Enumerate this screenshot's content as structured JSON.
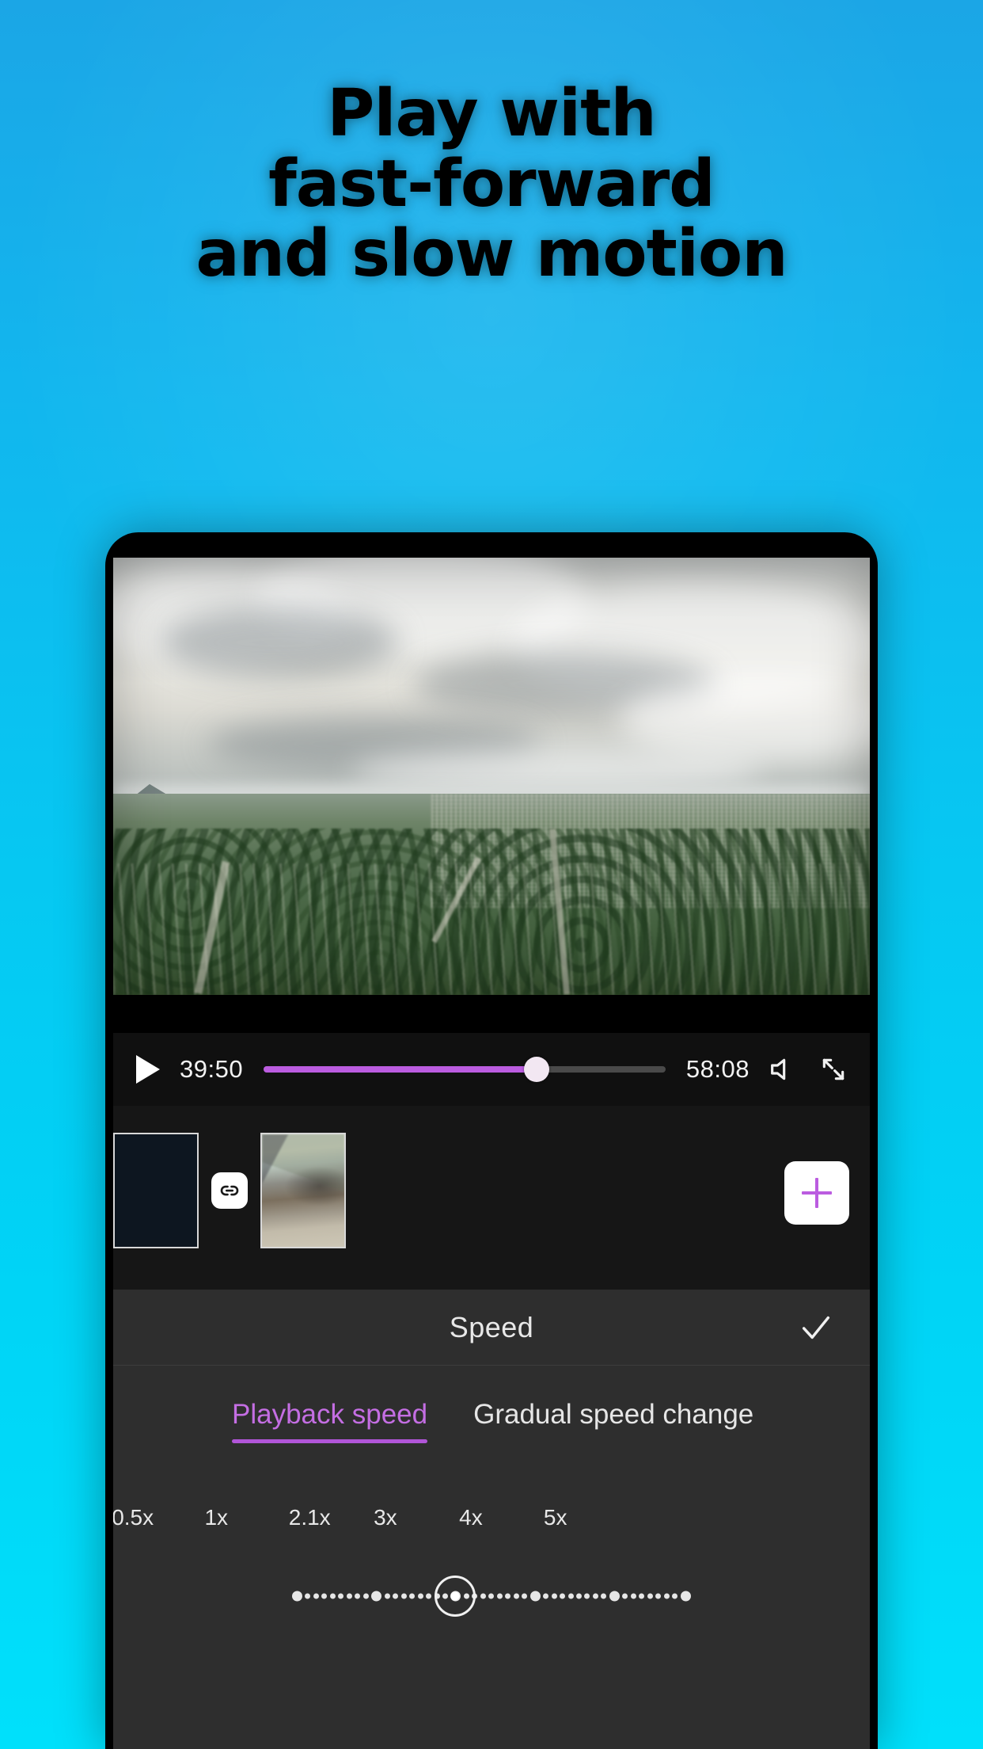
{
  "background": {
    "gradient_top": "#1BA6E6",
    "gradient_bottom": "#00E0FB"
  },
  "headline": {
    "text": "Play with\nfast-forward\nand slow motion",
    "color": "#000000"
  },
  "phone": {
    "video": {
      "description": "aerial-landscape-overcast-sky-green-valley-city"
    },
    "player": {
      "play_icon": "play-icon",
      "current_time": "39:50",
      "total_time": "58:08",
      "progress_percent": 68,
      "progress_color": "#BB5CE0",
      "volume_icon": "speaker-icon",
      "fullscreen_icon": "expand-arrows-icon"
    },
    "timeline": {
      "clips": [
        {
          "name": "clip-1",
          "state": "selected"
        },
        {
          "name": "clip-2",
          "state": "normal"
        }
      ],
      "link_icon": "link-chain-icon",
      "add_icon": "plus-icon",
      "add_icon_color": "#BB5CE0"
    },
    "speed_panel": {
      "title": "Speed",
      "confirm_icon": "check-icon",
      "tabs": [
        {
          "label": "Playback speed",
          "active": true
        },
        {
          "label": "Gradual speed change",
          "active": false
        }
      ],
      "accent_color": "#B155D8",
      "scale": {
        "labels": [
          "0.5x",
          "1x",
          "2.1x",
          "3x",
          "4x",
          "5x"
        ],
        "positions_percent": [
          13.5,
          22.0,
          31.5,
          39.2,
          47.9,
          56.5
        ],
        "current_value": "2.1x",
        "thumb_position_percent": 31.5,
        "total_dots": 45,
        "major_dot_indices": [
          0,
          9,
          18,
          27,
          36,
          44
        ]
      }
    }
  }
}
